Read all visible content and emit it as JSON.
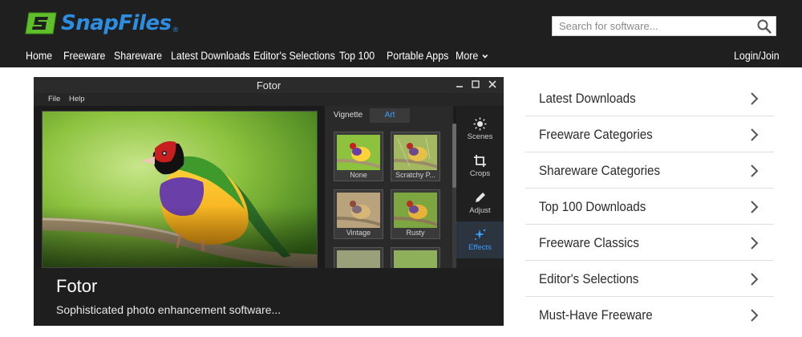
{
  "header": {
    "logo_text": "SnapFiles",
    "logo_reg": "®",
    "search_placeholder": "Search for software...",
    "nav": [
      {
        "label": "Home"
      },
      {
        "label": "Freeware"
      },
      {
        "label": "Shareware"
      },
      {
        "label": "Latest Downloads"
      },
      {
        "label": "Editor's Selections"
      },
      {
        "label": "Top 100"
      },
      {
        "label": "Portable Apps"
      },
      {
        "label": "More"
      }
    ],
    "login": "Login/Join",
    "icons": {
      "search": "search-icon",
      "more": "chevron-down-icon"
    }
  },
  "slide": {
    "window_title": "Fotor",
    "menu": [
      "File",
      "Help"
    ],
    "tabs": [
      {
        "label": "Vignette"
      },
      {
        "label": "Art",
        "active": true
      }
    ],
    "thumbnails": [
      "None",
      "Scratchy P...",
      "Vintage",
      "Rusty"
    ],
    "tools": [
      {
        "label": "Scenes",
        "icon": "sun-icon"
      },
      {
        "label": "Crops",
        "icon": "crop-icon"
      },
      {
        "label": "Adjust",
        "icon": "pencil-icon"
      },
      {
        "label": "Effects",
        "icon": "sparkle-icon",
        "active": true
      }
    ],
    "caption_title": "Fotor",
    "caption_desc": "Sophisticated photo enhancement software..."
  },
  "sidebar": {
    "items": [
      {
        "label": "Latest Downloads"
      },
      {
        "label": "Freeware Categories"
      },
      {
        "label": "Shareware Categories"
      },
      {
        "label": "Top 100 Downloads"
      },
      {
        "label": "Freeware Classics"
      },
      {
        "label": "Editor's Selections"
      },
      {
        "label": "Must-Have Freeware"
      }
    ]
  },
  "colors": {
    "header_bg": "#1f1f1f",
    "logo_green": "#5fbf2a",
    "logo_blue": "#2d8de0",
    "accent_blue": "#3aa0ff"
  }
}
